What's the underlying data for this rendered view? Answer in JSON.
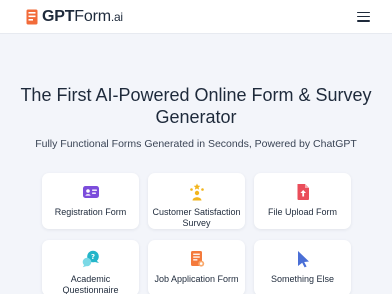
{
  "header": {
    "logo_main": "GPT",
    "logo_rest": "Form",
    "logo_suffix": ".ai",
    "brand_color": "#f26b3a",
    "menu_icon": "hamburger-menu-icon"
  },
  "hero": {
    "title": "The First AI-Powered Online Form & Survey Generator",
    "subtitle": "Fully Functional Forms Generated in Seconds, Powered by ChatGPT"
  },
  "cards": [
    {
      "label": "Registration Form",
      "icon": "id-card-icon",
      "color": "#7c4ddb"
    },
    {
      "label": "Customer Satisfaction Survey",
      "icon": "users-rating-icon",
      "color": "#f2b51d"
    },
    {
      "label": "File Upload Form",
      "icon": "file-upload-icon",
      "color": "#ea4d5a"
    },
    {
      "label": "Academic Questionnaire",
      "icon": "chat-bubbles-icon",
      "color": "#23b5c9"
    },
    {
      "label": "Job Application Form",
      "icon": "document-stamp-icon",
      "color": "#f47a3c"
    },
    {
      "label": "Something Else",
      "icon": "cursor-pointer-icon",
      "color": "#4a6fd6"
    }
  ]
}
